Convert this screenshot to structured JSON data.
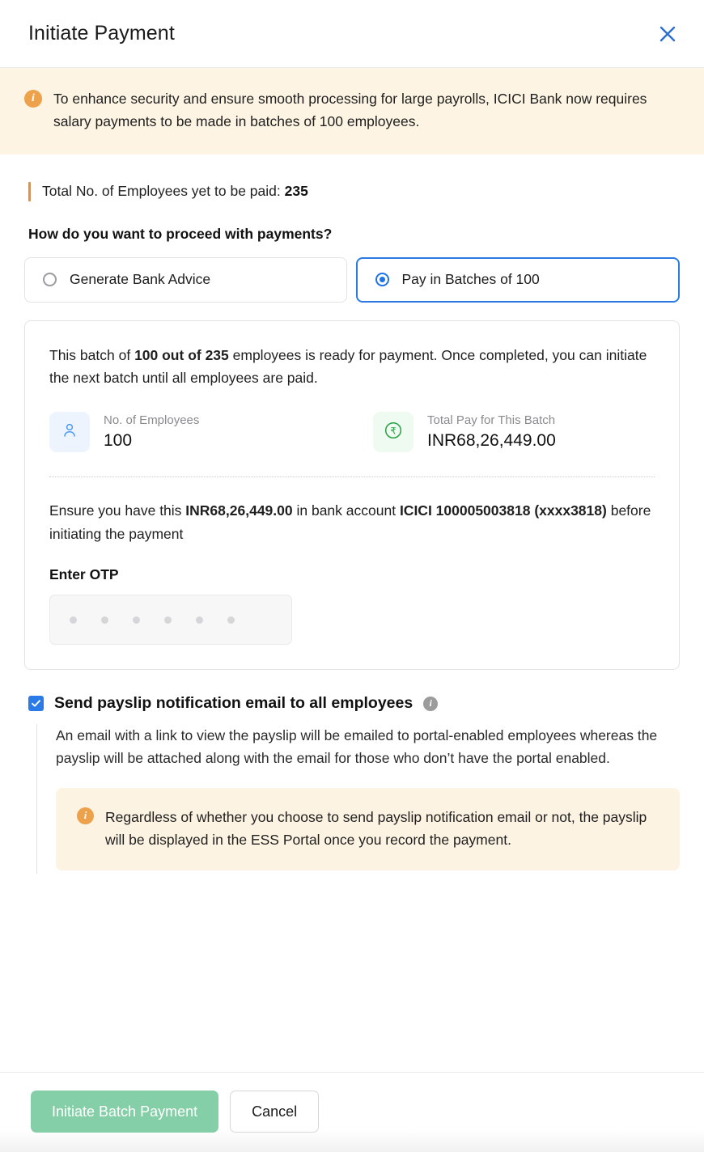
{
  "header": {
    "title": "Initiate Payment",
    "close_icon": "close-icon"
  },
  "banner": {
    "icon": "info-icon",
    "text": "To enhance security and ensure smooth processing for large payrolls, ICICI Bank now requires salary payments to be made in batches of 100 employees."
  },
  "summary": {
    "total_label": "Total No. of Employees yet to be paid: ",
    "total_value": "235",
    "question": "How do you want to proceed with payments?"
  },
  "options": [
    {
      "label": "Generate Bank Advice",
      "selected": false
    },
    {
      "label": "Pay in Batches of 100",
      "selected": true
    }
  ],
  "batch": {
    "desc_part1": "This batch of ",
    "desc_bold": "100 out of 235",
    "desc_part2": " employees is ready for payment. Once completed, you can initiate the next batch until all employees are paid.",
    "stats": [
      {
        "icon": "employee-icon",
        "label": "No. of Employees",
        "value": "100"
      },
      {
        "icon": "rupee-icon",
        "label": "Total Pay for This Batch",
        "value": "INR68,26,449.00"
      }
    ],
    "ensure_part1": "Ensure you have this ",
    "ensure_amount": "INR68,26,449.00",
    "ensure_part2": " in bank account ",
    "ensure_bank": "ICICI 100005003818 (xxxx3818)",
    "ensure_part3": " before initiating the payment",
    "otp_label": "Enter OTP",
    "otp_value": "",
    "otp_dots": 6
  },
  "notify": {
    "checked": true,
    "title": "Send payslip notification email to all employees",
    "info_icon": "info-icon",
    "description": "An email with a link to view the payslip will be emailed to portal-enabled employees whereas the payslip will be attached along with the email for those who don’t have the portal enabled.",
    "inner_banner": {
      "icon": "info-icon",
      "text": "Regardless of whether you choose to send payslip notification email or not, the payslip will be displayed in the ESS Portal once you record the payment."
    }
  },
  "footer": {
    "primary_label": "Initiate Batch Payment",
    "secondary_label": "Cancel"
  },
  "colors": {
    "accent_orange": "#f08c2e",
    "banner_bg": "#fdf4e3",
    "primary_blue": "#2c7be5",
    "primary_button_green": "#84cfa7",
    "checkbox_blue": "#2a7ae8",
    "rupee_green": "#25a244"
  }
}
